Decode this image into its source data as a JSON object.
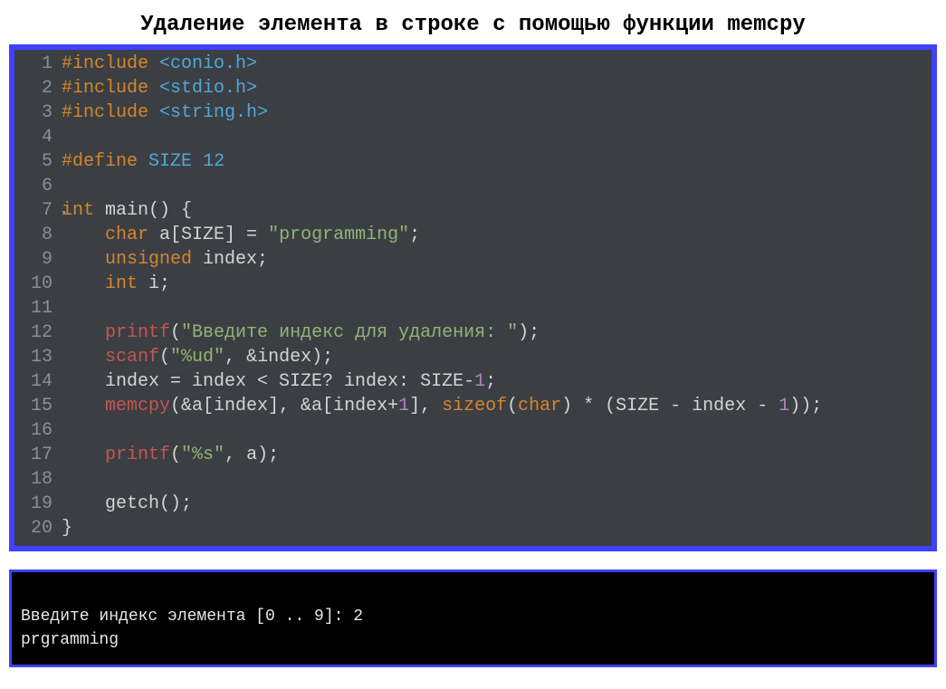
{
  "title": "Удаление элемента в строке с помощью функции memcpy",
  "code": {
    "lineNumbers": [
      "1",
      "2",
      "3",
      "4",
      "5",
      "6",
      "7",
      "8",
      "9",
      "10",
      "11",
      "12",
      "13",
      "14",
      "15",
      "16",
      "17",
      "18",
      "19",
      "20"
    ],
    "lines": [
      [
        {
          "t": "#include",
          "c": "kw-orange"
        },
        {
          "t": " "
        },
        {
          "t": "<conio.h>",
          "c": "kw-blue"
        }
      ],
      [
        {
          "t": "#include",
          "c": "kw-orange"
        },
        {
          "t": " "
        },
        {
          "t": "<stdio.h>",
          "c": "kw-blue"
        }
      ],
      [
        {
          "t": "#include",
          "c": "kw-orange"
        },
        {
          "t": " "
        },
        {
          "t": "<string.h>",
          "c": "kw-blue"
        }
      ],
      [],
      [
        {
          "t": "#define",
          "c": "kw-orange"
        },
        {
          "t": " "
        },
        {
          "t": "SIZE",
          "c": "kw-blue"
        },
        {
          "t": " "
        },
        {
          "t": "12",
          "c": "kw-blue"
        }
      ],
      [],
      [
        {
          "t": "int",
          "c": "kw-orange"
        },
        {
          "t": " main() {"
        }
      ],
      [
        {
          "t": "    "
        },
        {
          "t": "char",
          "c": "kw-orange"
        },
        {
          "t": " a[SIZE] = "
        },
        {
          "t": "\"programming\"",
          "c": "string"
        },
        {
          "t": ";"
        }
      ],
      [
        {
          "t": "    "
        },
        {
          "t": "unsigned",
          "c": "kw-orange"
        },
        {
          "t": " index;"
        }
      ],
      [
        {
          "t": "    "
        },
        {
          "t": "int",
          "c": "kw-orange"
        },
        {
          "t": " i;"
        }
      ],
      [],
      [
        {
          "t": "    "
        },
        {
          "t": "printf",
          "c": "fn-red"
        },
        {
          "t": "("
        },
        {
          "t": "\"Введите индекс для удаления: \"",
          "c": "string"
        },
        {
          "t": ");"
        }
      ],
      [
        {
          "t": "    "
        },
        {
          "t": "scanf",
          "c": "fn-red"
        },
        {
          "t": "("
        },
        {
          "t": "\"%ud\"",
          "c": "string"
        },
        {
          "t": ", &index);"
        }
      ],
      [
        {
          "t": "    index = index < SIZE? index: SIZE-"
        },
        {
          "t": "1",
          "c": "num"
        },
        {
          "t": ";"
        }
      ],
      [
        {
          "t": "    "
        },
        {
          "t": "memcpy",
          "c": "fn-red"
        },
        {
          "t": "(&a[index], &a[index+"
        },
        {
          "t": "1",
          "c": "num"
        },
        {
          "t": "], "
        },
        {
          "t": "sizeof",
          "c": "kw-orange"
        },
        {
          "t": "("
        },
        {
          "t": "char",
          "c": "kw-orange"
        },
        {
          "t": ") * (SIZE - index - "
        },
        {
          "t": "1",
          "c": "num"
        },
        {
          "t": "));"
        }
      ],
      [],
      [
        {
          "t": "    "
        },
        {
          "t": "printf",
          "c": "fn-red"
        },
        {
          "t": "("
        },
        {
          "t": "\"%s\"",
          "c": "string"
        },
        {
          "t": ", a);"
        }
      ],
      [],
      [
        {
          "t": "    getch();"
        }
      ],
      [
        {
          "t": "}"
        }
      ]
    ],
    "foldLine": 7
  },
  "console": {
    "line1": "Введите индекс элемента [0 .. 9]: 2",
    "line2": "prgramming"
  }
}
